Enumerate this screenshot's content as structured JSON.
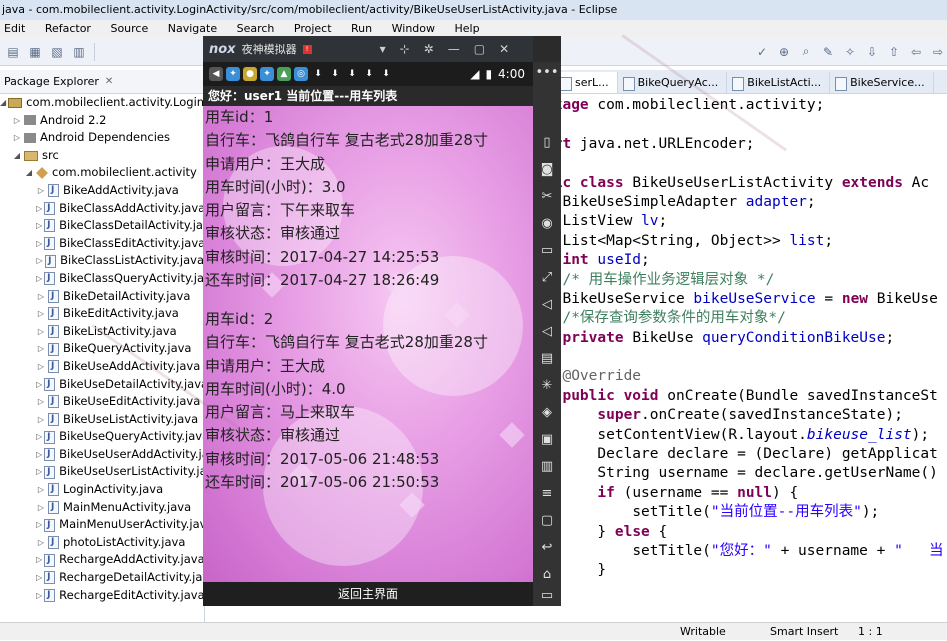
{
  "window": {
    "title": "java - com.mobileclient.activity.LoginActivity/src/com/mobileclient/activity/BikeUseUserListActivity.java - Eclipse"
  },
  "menu": [
    "Edit",
    "Refactor",
    "Source",
    "Navigate",
    "Search",
    "Project",
    "Run",
    "Window",
    "Help"
  ],
  "package_explorer": {
    "tab_label": "Package Explorer",
    "project": "com.mobileclient.activity.LoginActivity",
    "nodes": [
      "Android 2.2",
      "Android Dependencies",
      "src",
      "com.mobileclient.activity"
    ],
    "files": [
      "BikeAddActivity.java",
      "BikeClassAddActivity.java",
      "BikeClassDetailActivity.java",
      "BikeClassEditActivity.java",
      "BikeClassListActivity.java",
      "BikeClassQueryActivity.java",
      "BikeDetailActivity.java",
      "BikeEditActivity.java",
      "BikeListActivity.java",
      "BikeQueryActivity.java",
      "BikeUseAddActivity.java",
      "BikeUseDetailActivity.java",
      "BikeUseEditActivity.java",
      "BikeUseListActivity.java",
      "BikeUseQueryActivity.java",
      "BikeUseUserAddActivity.java",
      "BikeUseUserListActivity.java",
      "LoginActivity.java",
      "MainMenuActivity.java",
      "MainMenuUserActivity.java",
      "photoListActivity.java",
      "RechargeAddActivity.java",
      "RechargeDetailActivity.java",
      "RechargeEditActivity.java"
    ]
  },
  "editor": {
    "tabs": [
      "serL...",
      "BikeQueryAc...",
      "BikeListActi...",
      "BikeService..."
    ],
    "code": {
      "l1a": "ckage ",
      "l1b": "com.mobileclient.activity;",
      "l2a": "ort ",
      "l2b": "java.net.URLEncoder;",
      "l3a": "lic class ",
      "l3b": "BikeUseUserListActivity ",
      "l3c": "extends ",
      "l3d": "Ac",
      "l4a": "BikeUseSimpleAdapter ",
      "l4b": "adapter",
      "l4c": ";",
      "l5a": "ListView ",
      "l5b": "lv",
      "l5c": ";",
      "l6a": "List<Map<String, Object>> ",
      "l6b": "list",
      "l6c": ";",
      "l7a": "int ",
      "l7b": "useId",
      "l7c": ";",
      "l8": "/* 用车操作业务逻辑层对象 */",
      "l9a": "BikeUseService ",
      "l9b": "bikeUseService",
      "l9c": " = ",
      "l9d": "new ",
      "l9e": "BikeUse",
      "l10": "/*保存查询参数条件的用车对象*/",
      "l11a": "private ",
      "l11b": "BikeUse ",
      "l11c": "queryConditionBikeUse",
      "l11d": ";",
      "l12": "@Override",
      "l13a": "public void ",
      "l13b": "onCreate(Bundle savedInstanceSt",
      "l14a": "super",
      "l14b": ".onCreate(savedInstanceState);",
      "l15a": "setContentView(R.layout.",
      "l15b": "bikeuse_list",
      "l15c": ");",
      "l16a": "Declare declare = (Declare) getApplicat",
      "l17a": "String username = declare.getUserName()",
      "l18a": "if ",
      "l18b": "(username == ",
      "l18c": "null",
      "l18d": ") {",
      "l19a": "setTitle(",
      "l19b": "\"当前位置--用车列表\"",
      "l19c": ");",
      "l20a": "} ",
      "l20b": "else ",
      "l20c": "{",
      "l21a": "setTitle(",
      "l21b": "\"您好：\"",
      "l21c": " + username + ",
      "l21d": "\"   当",
      "l22": "}"
    }
  },
  "status": {
    "writable": "Writable",
    "insert": "Smart Insert",
    "position": "1 : 1"
  },
  "emulator": {
    "logo": "nox",
    "title": "夜神模拟器",
    "badge": "!",
    "time": "4:00",
    "app_title": "您好：user1  当前位置---用车列表",
    "records": [
      {
        "id_label": "用车id：1",
        "bike": "自行车：飞鸽自行车 复古老式28加重28寸",
        "user": "申请用户：王大成",
        "hours": "用车时间(小时)：3.0",
        "message": "用户留言：下午来取车",
        "status": "审核状态：审核通过",
        "review_time": "审核时间：2017-04-27 14:25:53",
        "return_time": "还车时间：2017-04-27 18:26:49"
      },
      {
        "id_label": "用车id：2",
        "bike": "自行车：飞鸽自行车 复古老式28加重28寸",
        "user": "申请用户：王大成",
        "hours": "用车时间(小时)：4.0",
        "message": "用户留言：马上来取车",
        "status": "审核状态：审核通过",
        "review_time": "审核时间：2017-05-06 21:48:53",
        "return_time": "还车时间：2017-05-06 21:50:53"
      }
    ],
    "back_button": "返回主界面"
  }
}
